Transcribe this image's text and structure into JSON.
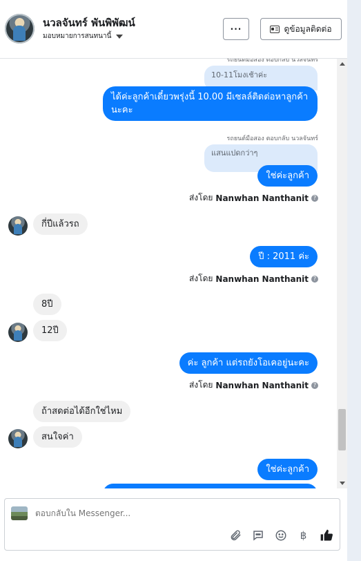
{
  "header": {
    "name": "นวลจันทร์ พันพิพัฒน์",
    "assign_label": "มอบหมายการสนทนานี้",
    "more_label": "···",
    "contact_label": "ดูข้อมูลติดต่อ"
  },
  "messages": {
    "m1_meta": "รถยนต์มือสอง ตอบกลับ นวลจันทร์",
    "m1_quote": "10-11โมงเช้าค่ะ",
    "m1_text": "ได้ค่ะลูกค้าเดี๋ยวพรุ่งนี้ 10.00 มีเซลล์ติดต่อหาลูกค้านะคะ",
    "m2_meta": "รถยนต์มือสอง ตอบกลับ นวลจันทร์",
    "m2_quote": "แสนแปดกว่าๆ",
    "m2_text": "ใช่ค่ะลูกค้า",
    "sent_by_prefix": "ส่งโดย",
    "sent_by_name": "Nanwhan Nanthanit",
    "in1": "กี่ปีแล้วรถ",
    "out3": "ปี : 2011 ค่ะ",
    "in2": "8ปี",
    "in3": "12ปี",
    "out4": "ค่ะ ลูกค้า แต่รถยังโอเคอยู่นะคะ",
    "in4": "ถ้าสดต่อได้อีกใช่ไหม",
    "in5": "สนใจค่า",
    "out5": "ใช่ค่ะลูกค้า"
  },
  "composer": {
    "placeholder": "ตอบกลับใน Messenger..."
  },
  "icons": {
    "attach": "paperclip-icon",
    "saved_reply": "chat-bubble-icon",
    "emoji": "smiley-icon",
    "payment": "baht-icon",
    "like": "thumbs-up-icon"
  },
  "colors": {
    "outgoing_bubble": "#0a7cff",
    "incoming_bubble": "#f0f0f0",
    "quote_bubble": "#dceafb"
  }
}
